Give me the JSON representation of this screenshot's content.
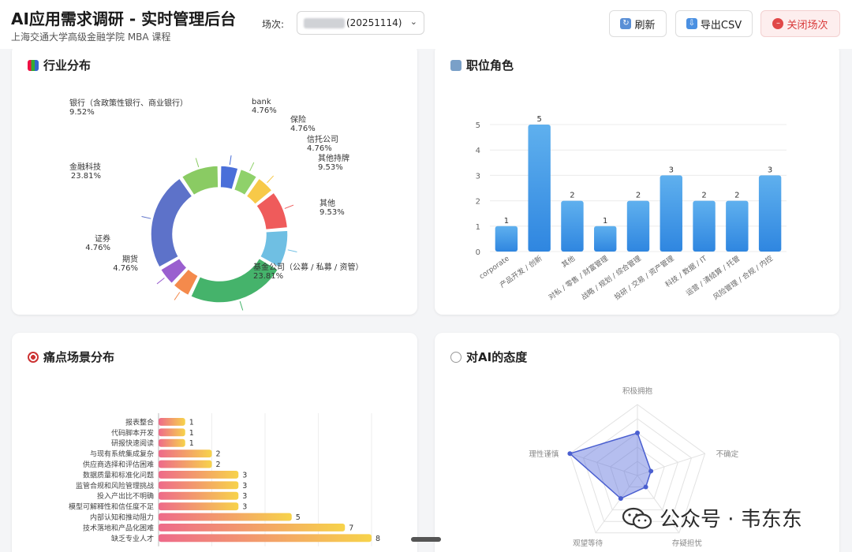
{
  "header": {
    "title": "AI应用需求调研 - 实时管理后台",
    "subtitle": "上海交通大学高级金融学院 MBA 课程",
    "session_label": "场次:",
    "session_value": "(20251114)",
    "refresh_label": "刷新",
    "export_label": "导出CSV",
    "close_label": "关闭场次"
  },
  "cards": {
    "industry_title": "行业分布",
    "role_title": "职位角色",
    "pain_title": "痛点场景分布",
    "attitude_title": "对AI的态度"
  },
  "watermark": {
    "text": "公众号 · 韦东东"
  },
  "colors": {
    "accent_blue": "#3b8fe6",
    "danger": "#d93a3a"
  },
  "chart_data": [
    {
      "type": "pie",
      "variant": "donut",
      "labels": [
        "bank",
        "保险",
        "信托公司",
        "其他持牌",
        "其他",
        "基金公司（公募 / 私募 / 资管）",
        "期货",
        "证券",
        "金融科技",
        "银行（含政策性银行、商业银行）"
      ],
      "values": [
        4.76,
        4.76,
        4.76,
        9.53,
        9.53,
        23.81,
        4.76,
        4.76,
        23.81,
        9.52
      ],
      "value_labels": [
        "4.76%",
        "4.76%",
        "4.76%",
        "9.53%",
        "9.53%",
        "23.81%",
        "4.76%",
        "4.76%",
        "23.81%",
        "9.52%"
      ],
      "colors": [
        "#4a6fd9",
        "#8fd16a",
        "#f7c948",
        "#ef5b5b",
        "#6fbfe3",
        "#45b36b",
        "#f48a4c",
        "#9a5fcf",
        "#5d72c9",
        "#8acb63"
      ]
    },
    {
      "type": "bar",
      "categories": [
        "corporate",
        "产品开发 / 创新",
        "其他",
        "对私 / 零售 / 财富管理",
        "战略 / 规划 / 综合管理",
        "投研 / 交易 / 资产管理",
        "科技 / 数据 / IT",
        "运营 / 清结算 / 托管",
        "风险管理 / 合规 / 内控"
      ],
      "values": [
        1,
        5,
        2,
        1,
        2,
        3,
        2,
        2,
        3
      ],
      "ylim": [
        0,
        5
      ],
      "yticks": [
        0,
        1,
        2,
        3,
        4,
        5
      ]
    },
    {
      "type": "bar",
      "orientation": "horizontal",
      "categories": [
        "报表整合",
        "代码脚本开发",
        "研报快速阅读",
        "与现有系统集成复杂",
        "供应商选择和评估困难",
        "数据质量和标准化问题",
        "监管合规和风险管理挑战",
        "投入产出比不明确",
        "模型可解释性和信任度不足",
        "内部认知和推动阻力",
        "技术落地和产品化困难",
        "缺乏专业人才"
      ],
      "values": [
        1,
        1,
        1,
        2,
        2,
        3,
        3,
        3,
        3,
        5,
        7,
        8
      ],
      "xlim": [
        0,
        8
      ]
    },
    {
      "type": "radar",
      "axes": [
        "积极拥抱",
        "不确定",
        "存疑担忧",
        "观望等待",
        "理性谨慎"
      ],
      "values": [
        3,
        1,
        1,
        2,
        5
      ],
      "rmax": 5
    }
  ]
}
